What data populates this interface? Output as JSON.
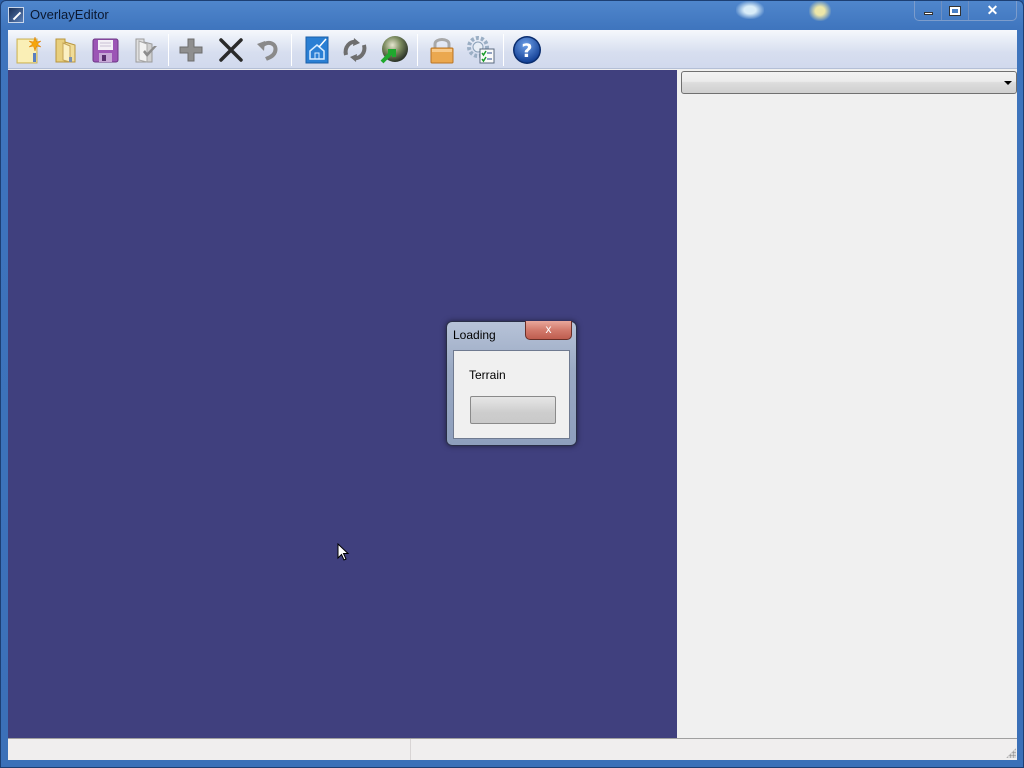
{
  "window": {
    "title": "OverlayEditor",
    "caption": {
      "minimize": "minimize",
      "maximize": "maximize",
      "close": "✕"
    }
  },
  "toolbar": {
    "buttons": [
      {
        "id": "new",
        "icon": "new-file-icon",
        "tooltip": "New"
      },
      {
        "id": "open",
        "icon": "open-folder-icon",
        "tooltip": "Open"
      },
      {
        "id": "save",
        "icon": "save-disk-icon",
        "tooltip": "Save"
      },
      {
        "id": "import",
        "icon": "import-icon",
        "tooltip": "Import"
      },
      {
        "id": "add",
        "icon": "add-plus-icon",
        "tooltip": "Add"
      },
      {
        "id": "delete",
        "icon": "delete-x-icon",
        "tooltip": "Delete"
      },
      {
        "id": "undo",
        "icon": "undo-icon",
        "tooltip": "Undo"
      },
      {
        "id": "airport",
        "icon": "airport-editor-icon",
        "tooltip": "Airport"
      },
      {
        "id": "reload",
        "icon": "reload-arrows-icon",
        "tooltip": "Reload"
      },
      {
        "id": "goto",
        "icon": "globe-goto-icon",
        "tooltip": "Go To"
      },
      {
        "id": "lock",
        "icon": "lock-icon",
        "tooltip": "Lock"
      },
      {
        "id": "preferences",
        "icon": "preferences-gear-icon",
        "tooltip": "Preferences"
      },
      {
        "id": "help",
        "icon": "help-icon",
        "tooltip": "Help",
        "glyph": "?"
      }
    ]
  },
  "sidepanel": {
    "combo_value": ""
  },
  "statusbar": {
    "pane1": "",
    "pane2": ""
  },
  "dialog": {
    "title": "Loading",
    "close_glyph": "x",
    "label": "Terrain",
    "progress_percent": 0
  },
  "colors": {
    "viewport_bg": "#40407e",
    "title_bar": "#3e74bd",
    "panel_bg": "#f0f0f0"
  }
}
